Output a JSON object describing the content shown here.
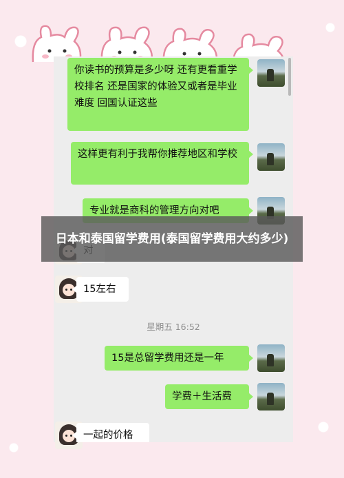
{
  "overlay_title": "日本和泰国留学费用(泰国留学费用大约多少)",
  "chat": {
    "timestamp": "星期五 16:52",
    "messages": [
      {
        "side": "me",
        "text": "你读书的预算是多少呀  还有更看重学校排名 还是国家的体验又或者是毕业难度 回国认证这些"
      },
      {
        "side": "me",
        "text": "这样更有利于我帮你推荐地区和学校"
      },
      {
        "side": "me",
        "text": "专业就是商科的管理方向对吧"
      },
      {
        "side": "other",
        "text": "对"
      },
      {
        "side": "other",
        "text": "15左右"
      },
      {
        "side": "me",
        "text": "15是总留学费用还是一年"
      },
      {
        "side": "me",
        "text": "学费＋生活费"
      },
      {
        "side": "other",
        "text": "一起的价格"
      }
    ]
  },
  "colors": {
    "bubble_me": "#95ec69",
    "bubble_other": "#ffffff",
    "chat_bg": "#ededed",
    "page_bg": "#fbe9ee"
  }
}
